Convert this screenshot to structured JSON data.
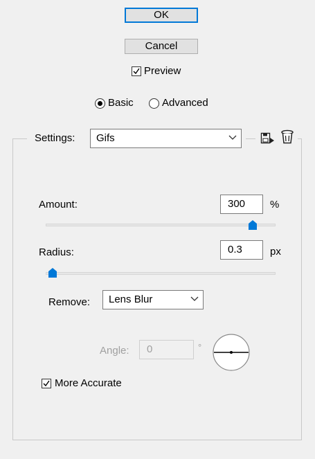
{
  "buttons": {
    "ok": "OK",
    "cancel": "Cancel"
  },
  "preview": {
    "label": "Preview",
    "checked": true
  },
  "mode": {
    "basic_label": "Basic",
    "advanced_label": "Advanced",
    "selected": "Basic"
  },
  "settings": {
    "label": "Settings:",
    "value": "Gifs",
    "save_icon": "save-preset-icon",
    "delete_icon": "trash-icon"
  },
  "amount": {
    "label": "Amount:",
    "value": "300",
    "unit": "%",
    "slider_fraction": 0.9
  },
  "radius": {
    "label": "Radius:",
    "value": "0.3",
    "unit": "px",
    "slider_fraction": 0.03
  },
  "remove": {
    "label": "Remove:",
    "value": "Lens Blur"
  },
  "angle": {
    "label": "Angle:",
    "value": "0",
    "unit": "°",
    "dial_icon": "angle-dial-icon"
  },
  "more_accurate": {
    "label": "More Accurate",
    "checked": true
  },
  "colors": {
    "accent": "#0078d7",
    "background": "#f0f0f0"
  }
}
